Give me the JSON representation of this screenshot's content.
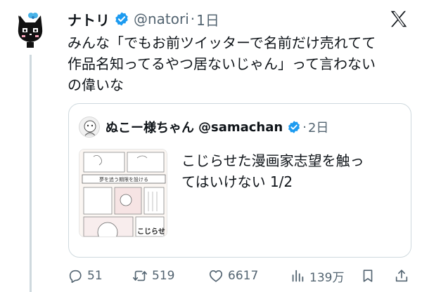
{
  "tweet": {
    "author_name": "ナトリ",
    "handle": "@natori",
    "separator": "·",
    "time": "1日",
    "text_lines": [
      "みんな「でもお前ツイッターで名前だけ売れてて",
      "作品名知ってるやつ居ないじゃん」って言わない",
      "の偉いな"
    ]
  },
  "quoted": {
    "author_name": "ぬこー様ちゃん",
    "handle": "@samachan",
    "separator": "·",
    "time": "2日",
    "text_lines": [
      "こじらせた漫画家志望を触っ",
      "てはいけない 1/2"
    ],
    "thumbnail": {
      "panel_caption": "夢を追う期限を設ける",
      "bottom_caption": "こじらせ"
    }
  },
  "actions": {
    "replies": "51",
    "retweets": "519",
    "likes": "6617",
    "views": "139万"
  },
  "colors": {
    "verified": "#1d9bf0",
    "text": "#0f1419",
    "muted": "#536471",
    "border": "#cfd9de"
  },
  "icons": [
    "x-logo-icon",
    "verified-icon",
    "reply-icon",
    "retweet-icon",
    "like-icon",
    "views-icon",
    "bookmark-icon",
    "share-icon"
  ]
}
